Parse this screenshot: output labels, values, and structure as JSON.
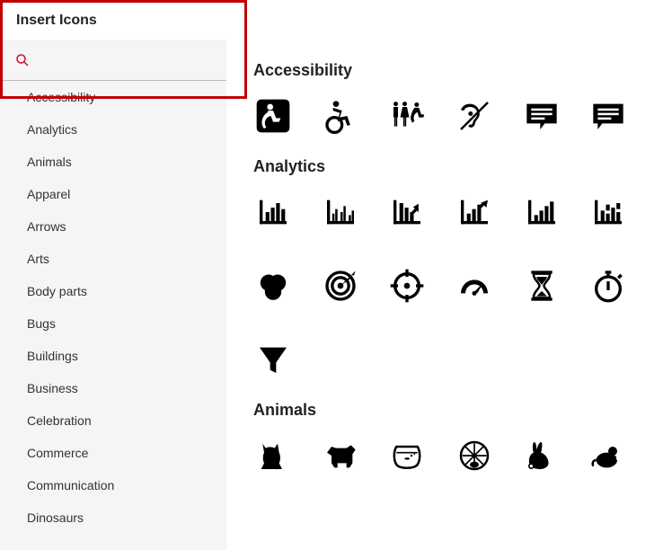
{
  "title": "Insert Icons",
  "search": {
    "placeholder": ""
  },
  "categories": [
    "Accessibility",
    "Analytics",
    "Animals",
    "Apparel",
    "Arrows",
    "Arts",
    "Body parts",
    "Bugs",
    "Buildings",
    "Business",
    "Celebration",
    "Commerce",
    "Communication",
    "Dinosaurs"
  ],
  "sections": {
    "accessibility": {
      "title": "Accessibility"
    },
    "analytics": {
      "title": "Analytics"
    },
    "animals": {
      "title": "Animals"
    }
  },
  "icons": {
    "accessibility": [
      "wheelchair-icon",
      "wheelchair-active-icon",
      "restroom-accessible-icon",
      "deaf-icon",
      "closed-caption-icon",
      "live-caption-icon"
    ],
    "analytics": [
      "bar-chart-icon",
      "bar-chart-grouped-icon",
      "bar-chart-down-icon",
      "bar-chart-up-icon",
      "bar-chart-rising-icon",
      "bar-chart-broken-icon",
      "venn-diagram-icon",
      "target-icon",
      "crosshair-icon",
      "gauge-icon",
      "hourglass-icon",
      "stopwatch-icon",
      "funnel-icon"
    ],
    "animals": [
      "cat-icon",
      "dog-icon",
      "fishbowl-icon",
      "hamster-wheel-icon",
      "rabbit-icon",
      "mouse-icon"
    ]
  }
}
